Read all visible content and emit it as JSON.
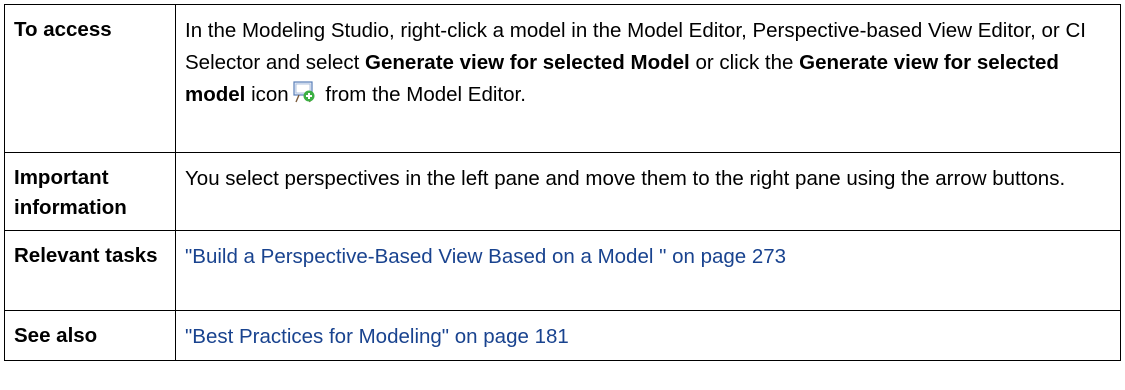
{
  "rows": {
    "access": {
      "label": "To access",
      "text1": "In the Modeling Studio, right-click a model in the Model Editor, Perspective-based View Editor, or CI Selector and select ",
      "bold1": "Generate view for selected Model",
      "text2": " or click the ",
      "bold2": "Generate view for selected model",
      "text3": " icon",
      "text4": " from the Model Editor.",
      "icon": "generate-view-icon"
    },
    "important": {
      "label": "Important information",
      "text": "You select perspectives in the left pane and move them to the right pane using the arrow buttons."
    },
    "relevant": {
      "label": "Relevant tasks",
      "link": "\"Build a Perspective-Based View Based on a Model \" on page 273"
    },
    "see_also": {
      "label": "See also",
      "link": "\"Best Practices for Modeling\" on page 181"
    }
  },
  "colors": {
    "link": "#19438f",
    "border": "#000000",
    "icon_green": "#3cb043",
    "icon_board": "#e8eef8"
  }
}
